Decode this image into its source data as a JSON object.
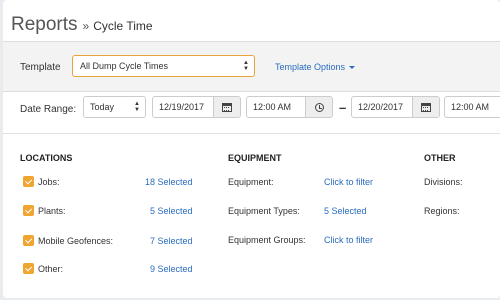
{
  "header": {
    "title": "Reports",
    "separator": "»",
    "subtitle": "Cycle Time"
  },
  "template": {
    "label": "Template",
    "selected": "All Dump Cycle Times",
    "options_link": "Template Options"
  },
  "date_range": {
    "label": "Date Range:",
    "preset": "Today",
    "start_date": "12/19/2017",
    "start_time": "12:00 AM",
    "separator": "–",
    "end_date": "12/20/2017",
    "end_time": "12:00 AM"
  },
  "locations": {
    "header": "LOCATIONS",
    "items": [
      {
        "label": "Jobs:",
        "value": "18 Selected",
        "checked": true
      },
      {
        "label": "Plants:",
        "value": "5 Selected",
        "checked": true
      },
      {
        "label": "Mobile Geofences:",
        "value": "7 Selected",
        "checked": true
      },
      {
        "label": "Other:",
        "value": "9 Selected",
        "checked": true
      }
    ]
  },
  "equipment": {
    "header": "EQUIPMENT",
    "items": [
      {
        "label": "Equipment:",
        "value": "Click to filter"
      },
      {
        "label": "Equipment Types:",
        "value": "5 Selected"
      },
      {
        "label": "Equipment Groups:",
        "value": "Click to filter"
      }
    ]
  },
  "other": {
    "header": "OTHER",
    "items": [
      {
        "label": "Divisions:"
      },
      {
        "label": "Regions:"
      }
    ]
  },
  "colors": {
    "accent_orange": "#f0a531",
    "link_blue": "#2a6cbf"
  },
  "icons": [
    "calendar-icon",
    "clock-icon",
    "caret-down-icon",
    "select-arrows-icon",
    "checkmark-icon"
  ]
}
